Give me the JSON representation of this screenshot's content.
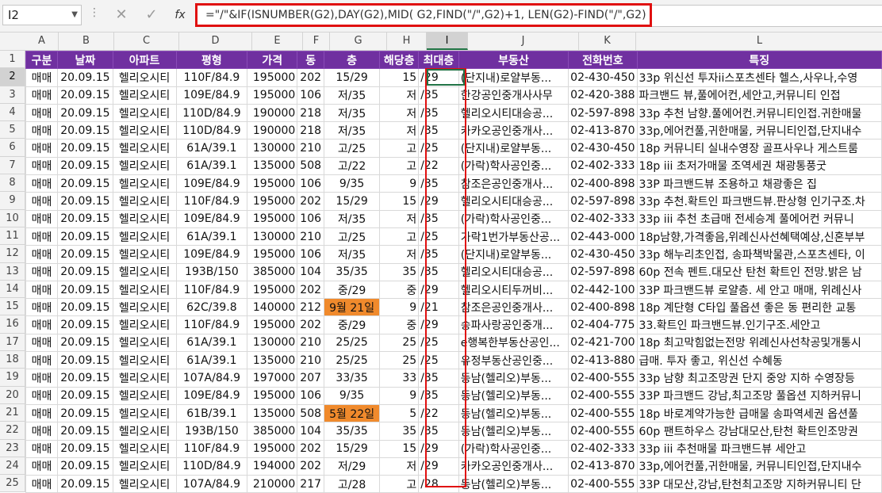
{
  "name_box": "I2",
  "formula_icons": {
    "cancel": "✕",
    "enter": "✓",
    "fx": "fx"
  },
  "formula": "=\"/\"&IF(ISNUMBER(G2),DAY(G2),MID( G2,FIND(\"/\",G2)+1, LEN(G2)-FIND(\"/\",G2) ))",
  "columns": [
    "A",
    "B",
    "C",
    "D",
    "E",
    "F",
    "G",
    "H",
    "I",
    "J",
    "K",
    "L"
  ],
  "row_numbers": [
    "1",
    "2",
    "3",
    "4",
    "5",
    "6",
    "7",
    "8",
    "9",
    "10",
    "11",
    "12",
    "13",
    "14",
    "15",
    "16",
    "17",
    "18",
    "19",
    "20",
    "21",
    "22",
    "23",
    "24",
    "25"
  ],
  "headers": [
    "구분",
    "날짜",
    "아파트",
    "평형",
    "가격",
    "동",
    "층",
    "해당층",
    "최대층",
    "부동산",
    "전화번호",
    "특징"
  ],
  "rows": [
    [
      "매매",
      "20.09.15",
      "헬리오시티",
      "110F/84.9",
      "195000",
      "202",
      "15/29",
      "15",
      "/29",
      "(단지내)로얄부동...",
      "02-430-450",
      "33p 위신선 투자ii스포츠센타 헬스,사우나,수영"
    ],
    [
      "매매",
      "20.09.15",
      "헬리오시티",
      "109E/84.9",
      "195000",
      "106",
      "저/35",
      "저",
      "/35",
      "한강공인중개사사무",
      "02-420-388",
      "파크밴드 뷰,풀에어컨,세안고,커뮤니티 인접"
    ],
    [
      "매매",
      "20.09.15",
      "헬리오시티",
      "110D/84.9",
      "190000",
      "218",
      "저/35",
      "저",
      "/35",
      "헬리오시티대승공...",
      "02-597-898",
      "33p 추천 남향.풀에어컨.커뮤니티인접.귀한매물"
    ],
    [
      "매매",
      "20.09.15",
      "헬리오시티",
      "110D/84.9",
      "190000",
      "218",
      "저/35",
      "저",
      "/35",
      "카카오공인중개사...",
      "02-413-870",
      "33p,에어컨풀,귀한매물, 커뮤니티인접,단지내수"
    ],
    [
      "매매",
      "20.09.15",
      "헬리오시티",
      "61A/39.1",
      "130000",
      "210",
      "고/25",
      "고",
      "/25",
      "(단지내)로얄부동...",
      "02-430-450",
      "18p 커뮤니티 실내수영장 골프사우나 게스트룸"
    ],
    [
      "매매",
      "20.09.15",
      "헬리오시티",
      "61A/39.1",
      "135000",
      "508",
      "고/22",
      "고",
      "/22",
      "(가락)학사공인중...",
      "02-402-333",
      "18p iii 초저가매물 조역세권 채광통풍굿"
    ],
    [
      "매매",
      "20.09.15",
      "헬리오시티",
      "109E/84.9",
      "195000",
      "106",
      "9/35",
      "9",
      "/35",
      "참조은공인중개사...",
      "02-400-898",
      "33P 파크밴드뷰 조용하고 채광좋은 집"
    ],
    [
      "매매",
      "20.09.15",
      "헬리오시티",
      "110F/84.9",
      "195000",
      "202",
      "15/29",
      "15",
      "/29",
      "헬리오시티대승공...",
      "02-597-898",
      "33p 추천.확트인 파크밴드뷰.판상형 인기구조.차"
    ],
    [
      "매매",
      "20.09.15",
      "헬리오시티",
      "109E/84.9",
      "195000",
      "106",
      "저/35",
      "저",
      "/35",
      "(가락)학사공인중...",
      "02-402-333",
      "33p iii 추천 초급매 전세승계 풀에어컨 커뮤니"
    ],
    [
      "매매",
      "20.09.15",
      "헬리오시티",
      "61A/39.1",
      "130000",
      "210",
      "고/25",
      "고",
      "/25",
      "가락1번가부동산공...",
      "02-443-000",
      "18p남향,가격좋음,위례신사선혜택예상,신혼부부"
    ],
    [
      "매매",
      "20.09.15",
      "헬리오시티",
      "109E/84.9",
      "195000",
      "106",
      "저/35",
      "저",
      "/35",
      "(단지내)로얄부동...",
      "02-430-450",
      "33p 해누리초인접, 송파책박물관,스포츠센타, 이"
    ],
    [
      "매매",
      "20.09.15",
      "헬리오시티",
      "193B/150",
      "385000",
      "104",
      "35/35",
      "35",
      "/35",
      "헬리오시티대승공...",
      "02-597-898",
      "60p 전속 펜트.대모산 탄천 확트인 전망.밝은 남"
    ],
    [
      "매매",
      "20.09.15",
      "헬리오시티",
      "110F/84.9",
      "195000",
      "202",
      "중/29",
      "중",
      "/29",
      "헬리오시티두꺼비...",
      "02-442-100",
      "33P 파크밴드뷰 로얄층. 세 안고 매매, 위례신사"
    ],
    [
      "매매",
      "20.09.15",
      "헬리오시티",
      "62C/39.8",
      "140000",
      "212",
      "9월 21일",
      "9",
      "/21",
      "참조은공인중개사...",
      "02-400-898",
      "18p 계단형 C타입 풀옵션 좋은 동 편리한 교통"
    ],
    [
      "매매",
      "20.09.15",
      "헬리오시티",
      "110F/84.9",
      "195000",
      "202",
      "중/29",
      "중",
      "/29",
      "송파사랑공인중개...",
      "02-404-775",
      "33.확트인 파크밴드뷰.인기구조.세안고"
    ],
    [
      "매매",
      "20.09.15",
      "헬리오시티",
      "61A/39.1",
      "130000",
      "210",
      "25/25",
      "25",
      "/25",
      "e행복한부동산공인...",
      "02-421-700",
      "18p 최고막힘없는전망 위례신사선착공및개통시"
    ],
    [
      "매매",
      "20.09.15",
      "헬리오시티",
      "61A/39.1",
      "135000",
      "210",
      "25/25",
      "25",
      "/25",
      "유정부동산공인중...",
      "02-413-880",
      "급매. 투자 좋고, 위신선 수혜동"
    ],
    [
      "매매",
      "20.09.15",
      "헬리오시티",
      "107A/84.9",
      "197000",
      "207",
      "33/35",
      "33",
      "/35",
      "동남(헬리오)부동...",
      "02-400-555",
      "33p 남향 최고조망권 단지 중앙 지하 수영장등"
    ],
    [
      "매매",
      "20.09.15",
      "헬리오시티",
      "109E/84.9",
      "195000",
      "106",
      "9/35",
      "9",
      "/35",
      "동남(헬리오)부동...",
      "02-400-555",
      "33P 파크밴드 강남,최고조망 풀옵션 지하커뮤니"
    ],
    [
      "매매",
      "20.09.15",
      "헬리오시티",
      "61B/39.1",
      "135000",
      "508",
      "5월 22일",
      "5",
      "/22",
      "동남(헬리오)부동...",
      "02-400-555",
      "18p 바로계약가능한 급매물 송파역세권 옵션풀"
    ],
    [
      "매매",
      "20.09.15",
      "헬리오시티",
      "193B/150",
      "385000",
      "104",
      "35/35",
      "35",
      "/35",
      "동남(헬리오)부동...",
      "02-400-555",
      "60p 팬트하우스 강남대모산,탄천 확트인조망권"
    ],
    [
      "매매",
      "20.09.15",
      "헬리오시티",
      "110F/84.9",
      "195000",
      "202",
      "15/29",
      "15",
      "/29",
      "(가락)학사공인중...",
      "02-402-333",
      "33p iii 추천매물 파크밴드뷰 세안고"
    ],
    [
      "매매",
      "20.09.15",
      "헬리오시티",
      "110D/84.9",
      "194000",
      "202",
      "저/29",
      "저",
      "/29",
      "카카오공인중개사...",
      "02-413-870",
      "33p,에어컨풀,귀한매물, 커뮤니티인접,단지내수"
    ],
    [
      "매매",
      "20.09.15",
      "헬리오시티",
      "107A/84.9",
      "210000",
      "217",
      "고/28",
      "고",
      "/28",
      "동남(헬리오)부동...",
      "02-400-555",
      "33P 대모산,강남,탄천최고조망 지하커뮤니티 단"
    ]
  ],
  "highlight_color": "#f08a2c",
  "header_color": "#7030a0"
}
